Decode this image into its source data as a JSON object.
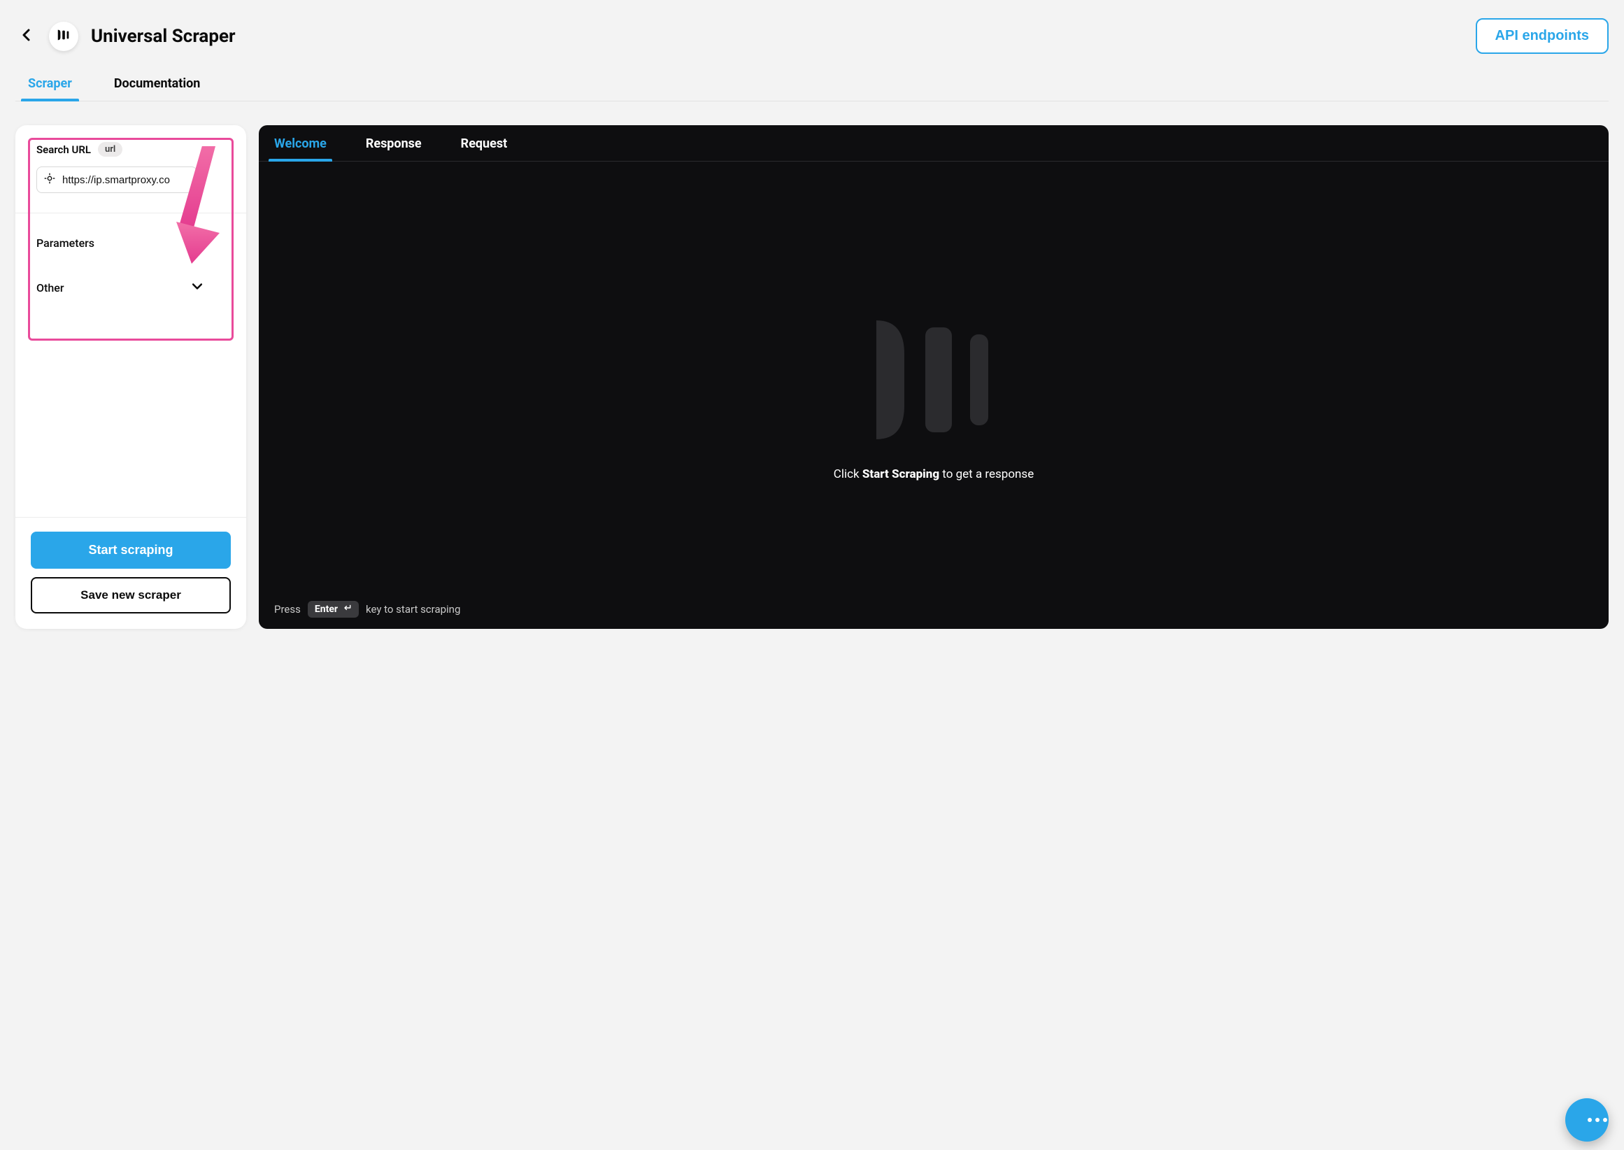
{
  "header": {
    "title": "Universal Scraper",
    "api_button": "API endpoints"
  },
  "top_tabs": {
    "scraper": "Scraper",
    "documentation": "Documentation",
    "active": "scraper"
  },
  "sidebar": {
    "search_url": {
      "label": "Search URL",
      "chip": "url",
      "value": "https://ip.smartproxy.co"
    },
    "accordion": {
      "parameters": "Parameters",
      "other": "Other"
    },
    "actions": {
      "start": "Start scraping",
      "save": "Save new scraper"
    }
  },
  "main_panel": {
    "tabs": {
      "welcome": "Welcome",
      "response": "Response",
      "request": "Request",
      "active": "welcome"
    },
    "message": {
      "prefix": "Click ",
      "bold": "Start Scraping",
      "suffix": " to get a response"
    },
    "footer": {
      "press": "Press",
      "enter": "Enter",
      "suffix": "key to start scraping"
    }
  },
  "icons": {
    "brand": "brand-bars-icon",
    "chat": "chat-bubble-icon"
  },
  "colors": {
    "accent": "#2aa6e9",
    "highlight": "#e94b9b"
  }
}
